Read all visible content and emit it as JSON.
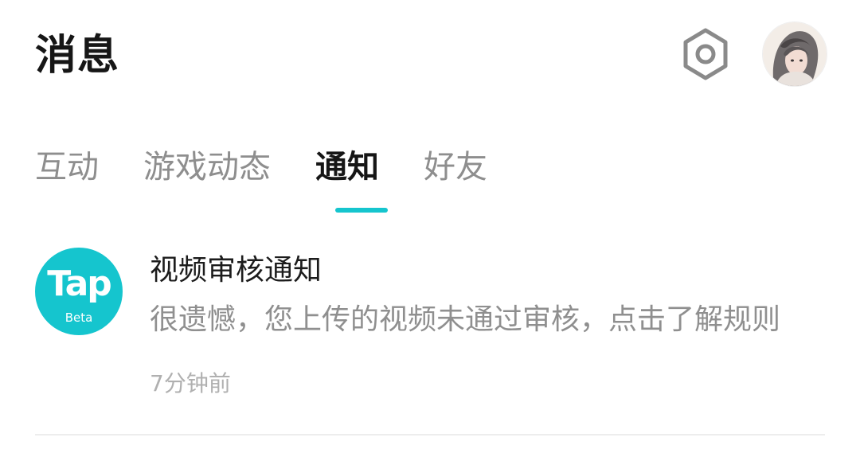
{
  "header": {
    "title": "消息",
    "settings_icon": "hexagon-settings-icon",
    "avatar_icon": "user-avatar"
  },
  "tabs": [
    {
      "label": "互动",
      "active": false
    },
    {
      "label": "游戏动态",
      "active": false
    },
    {
      "label": "通知",
      "active": true
    },
    {
      "label": "好友",
      "active": false
    }
  ],
  "accent_color": "#15c5ce",
  "notifications": [
    {
      "logo_text": "Tap",
      "logo_badge": "Beta",
      "title": "视频审核通知",
      "body": "很遗憾，您上传的视频未通过审核，点击了解规则",
      "time": "7分钟前"
    }
  ]
}
